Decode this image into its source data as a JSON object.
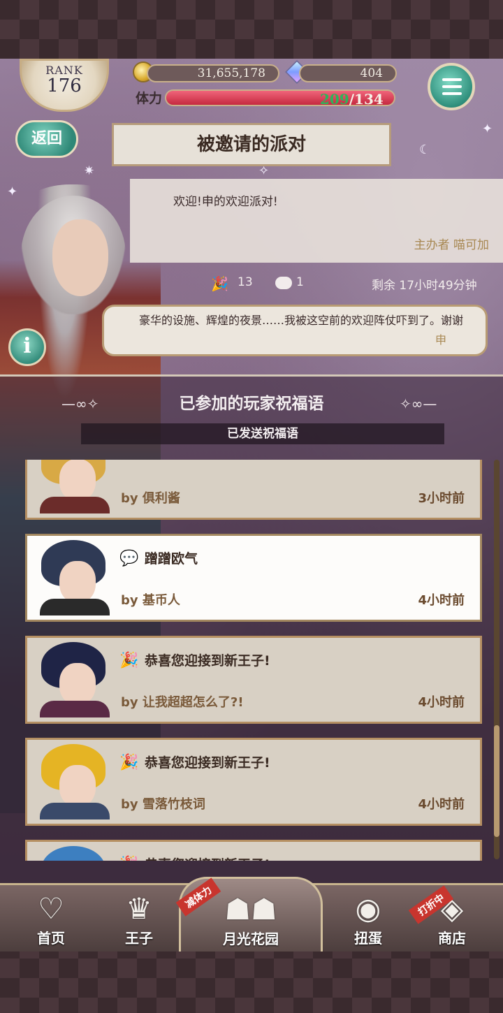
{
  "hud": {
    "rank_label": "RANK",
    "rank_value": "176",
    "coins": "31,655,178",
    "gems": "404",
    "stamina_label": "体力",
    "stamina_current": "209",
    "stamina_max": "/134",
    "stamina_fraction": 1.0
  },
  "header": {
    "back_label": "返回",
    "title": "被邀请的派对"
  },
  "party": {
    "host_message": "欢迎!申的欢迎派对!",
    "host_label": "主办者 喵可加",
    "confetti_count": "13",
    "comment_count": "1",
    "remaining": "剩余 17小时49分钟",
    "speech_text": "豪华的设施、辉煌的夜景……我被这空前的欢迎阵仗吓到了。谢谢",
    "speech_from": "申",
    "info_label": "i"
  },
  "blessings": {
    "section_title": "已参加的玩家祝福语",
    "subheader": "已发送祝福语",
    "items": [
      {
        "message": "",
        "by": "by 俱利酱",
        "time": "3小时前",
        "icon": "none",
        "hair": "#d8a945",
        "body": "#6b2c2a"
      },
      {
        "message": "蹭蹭欧气",
        "by": "by 基币人",
        "time": "4小时前",
        "icon": "chat-bubble-icon",
        "hair": "#2f3a55",
        "body": "#2a2a2a"
      },
      {
        "message": "恭喜您迎接到新王子!",
        "by": "by 让我超超怎么了?!",
        "time": "4小时前",
        "icon": "confetti-icon",
        "hair": "#1f2446",
        "body": "#5a2a45"
      },
      {
        "message": "恭喜您迎接到新王子!",
        "by": "by 雪落竹枝词",
        "time": "4小时前",
        "icon": "confetti-icon",
        "hair": "#e5b424",
        "body": "#3a4a6a"
      },
      {
        "message": "恭喜您迎接到新王子!",
        "by": "",
        "time": "",
        "icon": "confetti-icon",
        "hair": "#3d7fc0",
        "body": "#444"
      }
    ]
  },
  "nav": {
    "home": "首页",
    "prince": "王子",
    "garden": "月光花园",
    "garden_badge": "减体力",
    "gacha": "扭蛋",
    "shop": "商店",
    "shop_badge": "打折中"
  },
  "colors": {
    "accent_teal": "#2f8877",
    "stamina_red": "#c5293f",
    "gold_border": "#b58f62"
  }
}
